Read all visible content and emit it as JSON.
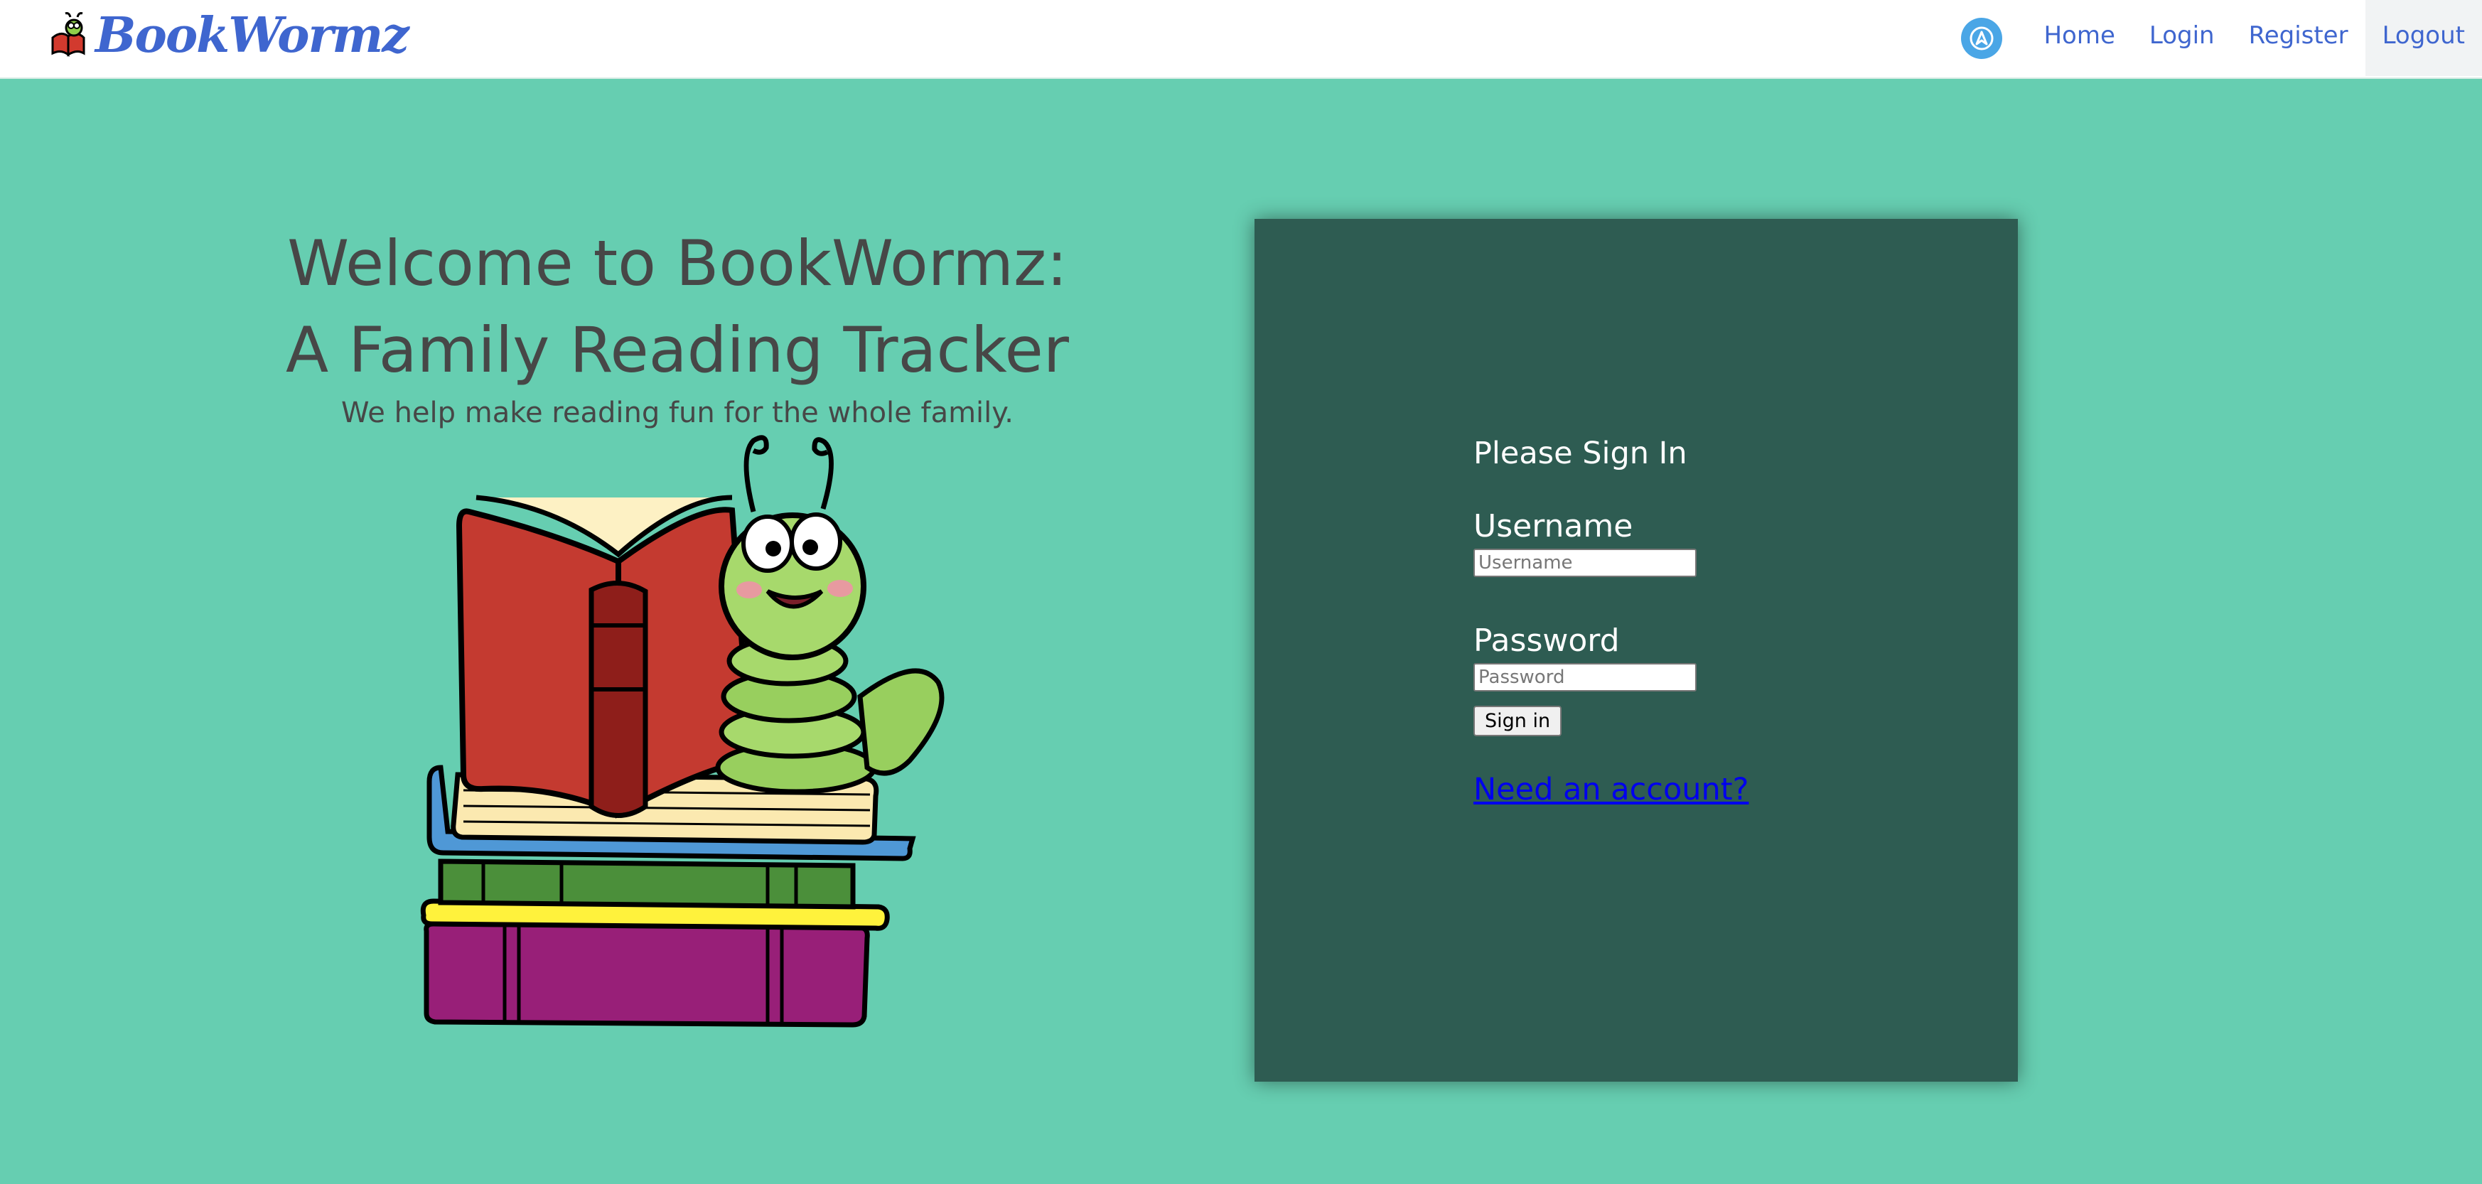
{
  "brand": {
    "name": "BookWormz",
    "logo_icon": "bookworm-logo-icon"
  },
  "nav": {
    "avatar_icon": "user-avatar-icon",
    "items": [
      {
        "label": "Home"
      },
      {
        "label": "Login"
      },
      {
        "label": "Register"
      },
      {
        "label": "Logout"
      }
    ]
  },
  "hero": {
    "title_line1": "Welcome to BookWormz:",
    "title_line2": "A Family Reading Tracker",
    "subtitle": "We help make reading fun for the whole family.",
    "illustration": "bookworm-reading-on-books-illustration"
  },
  "signin": {
    "heading": "Please Sign In",
    "username_label": "Username",
    "username_placeholder": "Username",
    "username_value": "",
    "password_label": "Password",
    "password_placeholder": "Password",
    "password_value": "",
    "submit_label": "Sign in",
    "register_link": "Need an account?"
  },
  "colors": {
    "background": "#66ceb1",
    "panel": "#2e5c52",
    "accent": "#3f66cf",
    "heading_text": "#474747"
  }
}
